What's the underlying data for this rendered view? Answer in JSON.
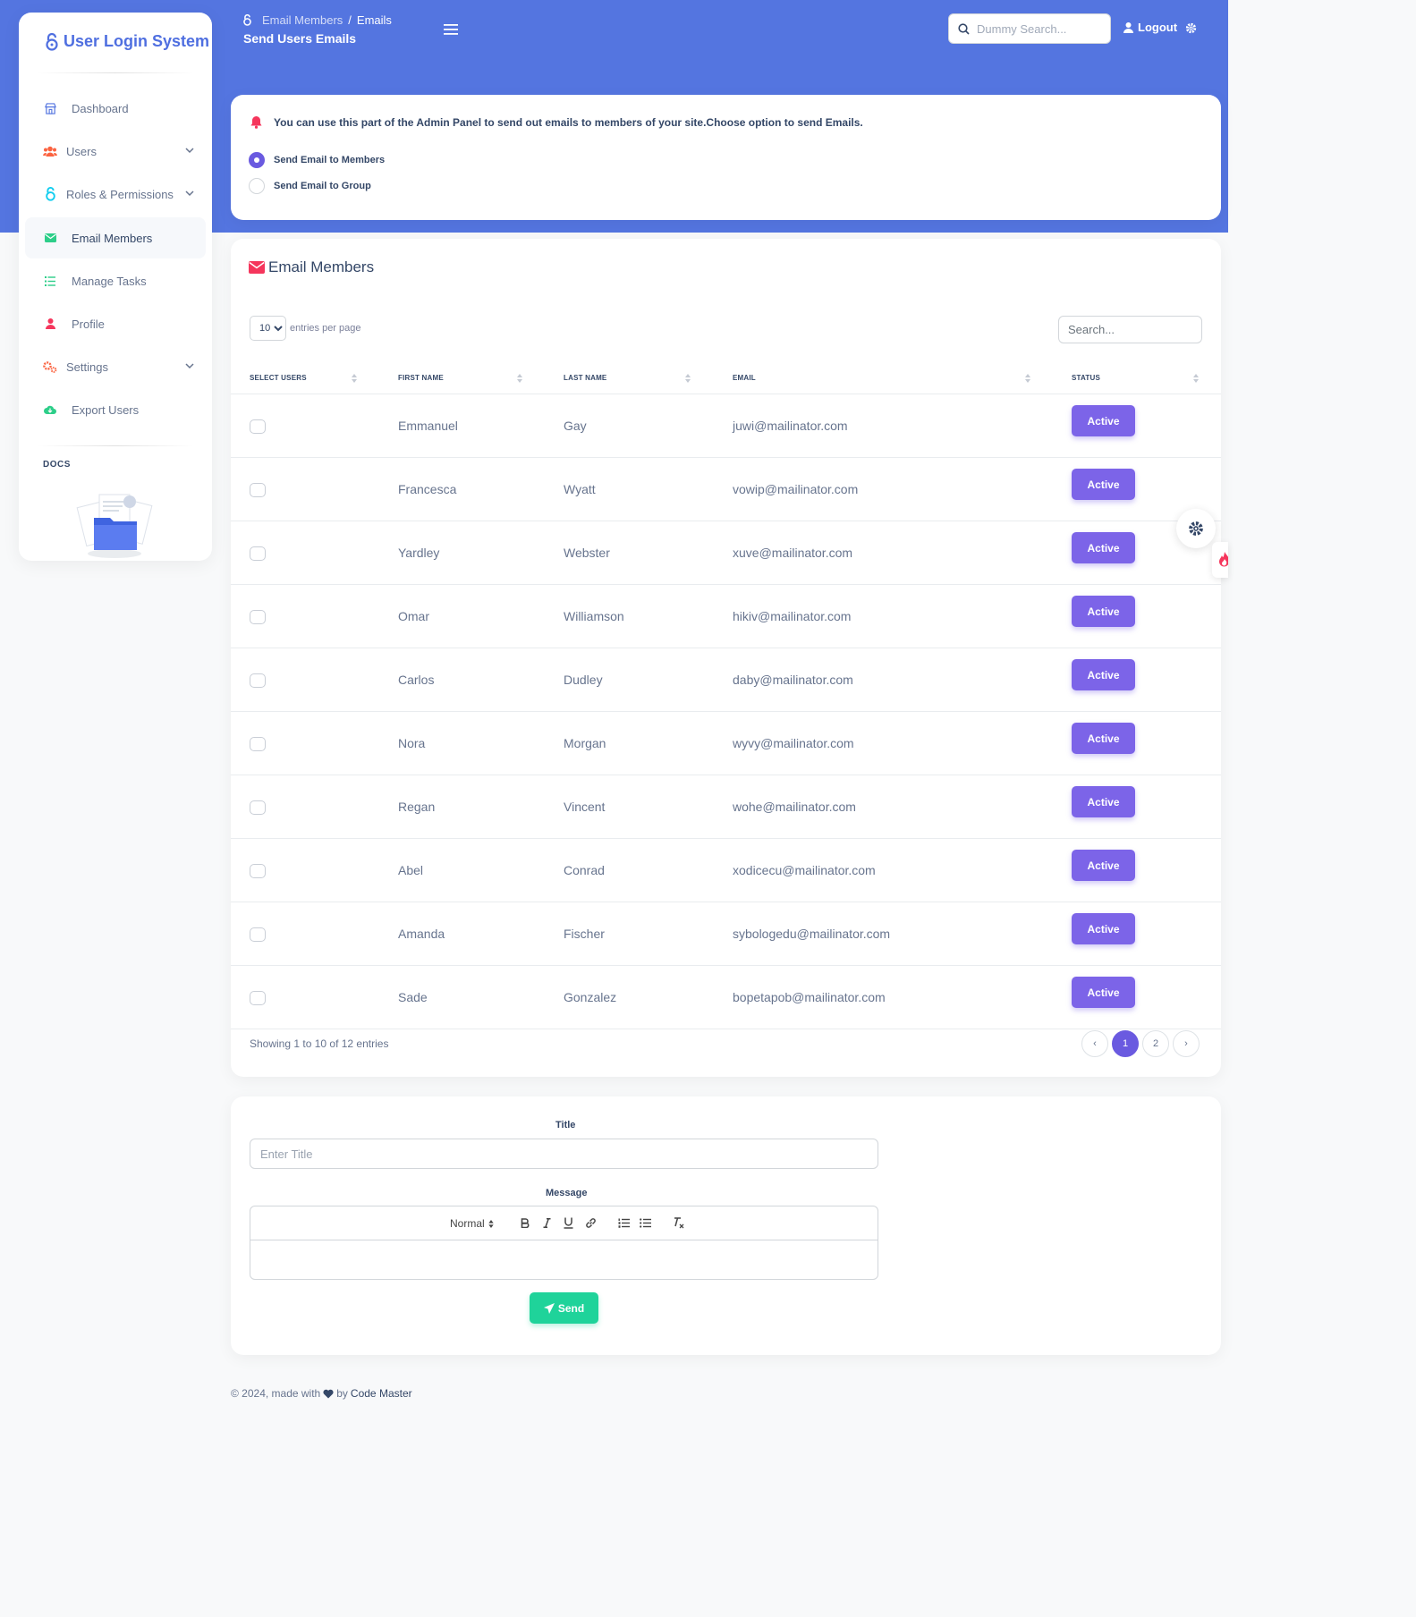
{
  "brand": {
    "name": "User Login System"
  },
  "sidebar": {
    "items": [
      {
        "label": "Dashboard",
        "icon": "shop-icon"
      },
      {
        "label": "Users",
        "icon": "users-icon",
        "expandable": true
      },
      {
        "label": "Roles & Permissions",
        "icon": "lock-icon",
        "expandable": true
      },
      {
        "label": "Email Members",
        "icon": "envelope-icon",
        "active": true
      },
      {
        "label": "Manage Tasks",
        "icon": "list-icon"
      },
      {
        "label": "Profile",
        "icon": "user-icon"
      },
      {
        "label": "Settings",
        "icon": "cogs-icon",
        "expandable": true
      },
      {
        "label": "Export Users",
        "icon": "cloud-download-icon"
      }
    ],
    "docs_label": "DOCS"
  },
  "header": {
    "breadcrumb": [
      "Email Members",
      "Emails"
    ],
    "page_title": "Send Users Emails",
    "search_placeholder": "Dummy Search...",
    "logout_label": "Logout"
  },
  "notice": {
    "text": "You can use this part of the Admin Panel to send out emails to members of your site.Choose option to send Emails.",
    "options": [
      {
        "label": "Send Email to Members",
        "selected": true
      },
      {
        "label": "Send Email to Group",
        "selected": false
      }
    ]
  },
  "table": {
    "title": "Email Members",
    "entries_value": "10",
    "entries_label": "entries per page",
    "search_placeholder": "Search...",
    "columns": [
      "SELECT USERS",
      "FIRST NAME",
      "LAST NAME",
      "EMAIL",
      "STATUS"
    ],
    "rows": [
      {
        "first": "Emmanuel",
        "last": "Gay",
        "email": "juwi@mailinator.com",
        "status": "Active"
      },
      {
        "first": "Francesca",
        "last": "Wyatt",
        "email": "vowip@mailinator.com",
        "status": "Active"
      },
      {
        "first": "Yardley",
        "last": "Webster",
        "email": "xuve@mailinator.com",
        "status": "Active"
      },
      {
        "first": "Omar",
        "last": "Williamson",
        "email": "hikiv@mailinator.com",
        "status": "Active"
      },
      {
        "first": "Carlos",
        "last": "Dudley",
        "email": "daby@mailinator.com",
        "status": "Active"
      },
      {
        "first": "Nora",
        "last": "Morgan",
        "email": "wyvy@mailinator.com",
        "status": "Active"
      },
      {
        "first": "Regan",
        "last": "Vincent",
        "email": "wohe@mailinator.com",
        "status": "Active"
      },
      {
        "first": "Abel",
        "last": "Conrad",
        "email": "xodicecu@mailinator.com",
        "status": "Active"
      },
      {
        "first": "Amanda",
        "last": "Fischer",
        "email": "sybologedu@mailinator.com",
        "status": "Active"
      },
      {
        "first": "Sade",
        "last": "Gonzalez",
        "email": "bopetapob@mailinator.com",
        "status": "Active"
      }
    ],
    "showing_text": "Showing 1 to 10 of 12 entries",
    "pagination": {
      "prev": "‹",
      "pages": [
        "1",
        "2"
      ],
      "current": "1",
      "next": "›"
    }
  },
  "form": {
    "title_label": "Title",
    "title_placeholder": "Enter Title",
    "message_label": "Message",
    "editor_format": "Normal",
    "send_label": "Send"
  },
  "footer": {
    "prefix": "© 2024, made with",
    "middle": "by",
    "author": "Code Master"
  },
  "colors": {
    "primary": "#5475e0",
    "accent": "#6a5ae0",
    "badge": "#7c64e8",
    "success": "#1fd39a",
    "danger": "#f5365c"
  }
}
